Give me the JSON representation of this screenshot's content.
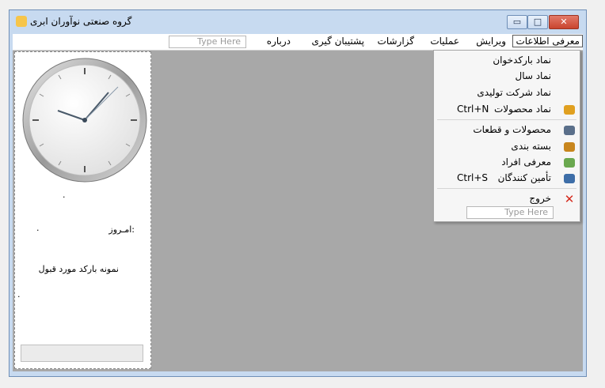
{
  "window": {
    "title": "گروه صنعتی نوآوران ابری",
    "caption_buttons": {
      "minimize_icon": "minimize-icon",
      "maximize_icon": "maximize-icon",
      "close_icon": "close-icon"
    }
  },
  "menubar": {
    "items": [
      "معرفی اطلاعات",
      "ویرایش",
      "عملیات",
      "گزارشات",
      "پشتیبان گیری",
      "درباره"
    ],
    "search_placeholder": "Type Here"
  },
  "left_panel": {
    "today_label": "امـروز:",
    "barcode_caption": "نمونه بارکد مورد قبول",
    "dots": [
      ".",
      ".",
      "."
    ]
  },
  "dropdown": {
    "items": [
      {
        "label": "نماد بارکدخوان",
        "shortcut": "",
        "icon": ""
      },
      {
        "label": "نماد سال",
        "shortcut": "",
        "icon": ""
      },
      {
        "label": "نماد شرکت تولیدی",
        "shortcut": "",
        "icon": ""
      },
      {
        "label": "نماد محصولات",
        "shortcut": "Ctrl+N",
        "icon": "truck-icon"
      },
      {
        "label": "محصولات و قطعات",
        "shortcut": "",
        "icon": "car-icon"
      },
      {
        "label": "بسته بندی",
        "shortcut": "",
        "icon": "box-icon"
      },
      {
        "label": "معرفی افراد",
        "shortcut": "",
        "icon": "people-icon"
      },
      {
        "label": "تأمین کنندگان",
        "shortcut": "Ctrl+S",
        "icon": "supplier-car-icon"
      },
      {
        "label": "خروج",
        "shortcut": "",
        "icon": "exit-icon"
      }
    ],
    "search_placeholder": "Type Here"
  },
  "colors": {
    "window_frame": "#c7daf0",
    "client_bg": "#a8a8a8",
    "close_button": "#c9442e",
    "exit_icon": "#d52b1e"
  }
}
